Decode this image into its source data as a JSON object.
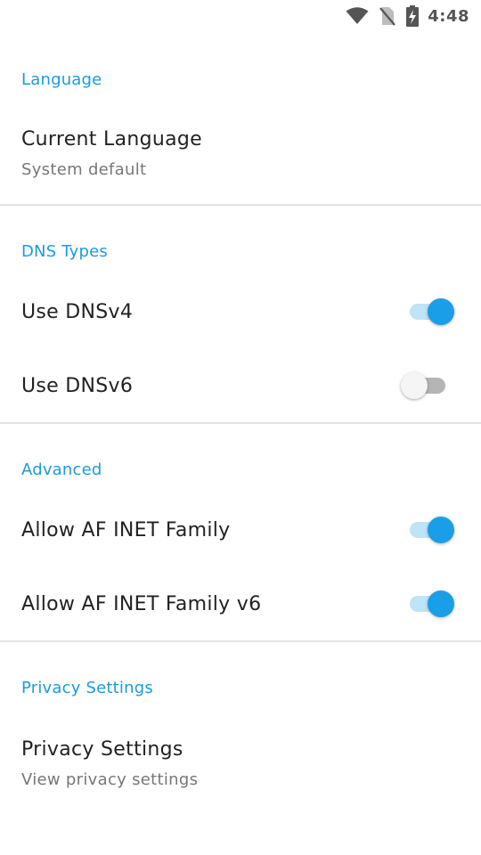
{
  "status_bar": {
    "time": "4:48",
    "icons": [
      "wifi-icon",
      "no-sim-icon",
      "battery-charging-icon"
    ]
  },
  "sections": [
    {
      "header": "Language",
      "rows": [
        {
          "title": "Current Language",
          "summary": "System default"
        }
      ]
    },
    {
      "header": "DNS Types",
      "rows": [
        {
          "title": "Use DNSv4",
          "switch_on": true
        },
        {
          "title": "Use DNSv6",
          "switch_on": false
        }
      ]
    },
    {
      "header": "Advanced",
      "rows": [
        {
          "title": "Allow AF INET Family",
          "switch_on": true
        },
        {
          "title": "Allow AF INET Family v6",
          "switch_on": true
        }
      ]
    },
    {
      "header": "Privacy Settings",
      "rows": [
        {
          "title": "Privacy Settings",
          "summary": "View privacy settings"
        }
      ]
    }
  ],
  "colors": {
    "accent": "#1a9be0",
    "switch_on_thumb": "#1b9ee8",
    "switch_on_track": "#bfe3f7",
    "switch_off_thumb": "#f5f5f5",
    "switch_off_track": "#b5b5b5",
    "divider": "#e2e2e2"
  }
}
